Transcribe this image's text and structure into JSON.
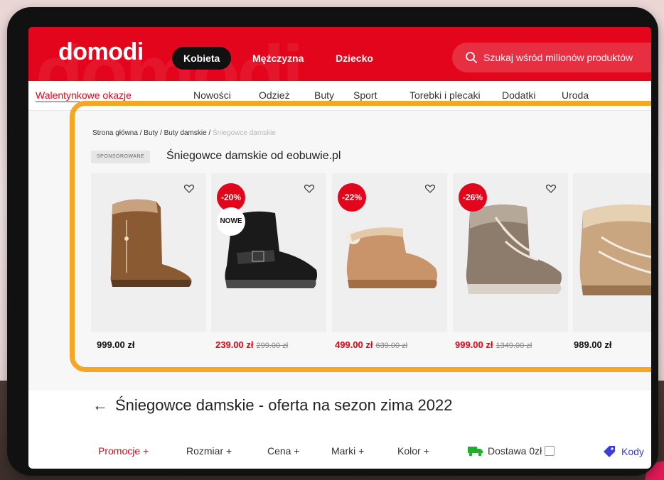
{
  "header": {
    "logo": "domodi",
    "tabs": [
      {
        "label": "Kobieta",
        "active": true
      },
      {
        "label": "Mężczyzna",
        "active": false
      },
      {
        "label": "Dziecko",
        "active": false
      }
    ],
    "search_placeholder": "Szukaj wśród milionów produktów"
  },
  "subnav": {
    "items": [
      "Walentynkowe okazje",
      "Nowości",
      "Odzież",
      "Buty",
      "Sport",
      "Torebki i plecaki",
      "Dodatki",
      "Uroda"
    ]
  },
  "breadcrumb": {
    "items": [
      "Strona główna",
      "Buty",
      "Buty damskie"
    ],
    "current": "Śniegowce damskie"
  },
  "sponsored": {
    "tag": "SPONSOROWANE",
    "title": "Śniegowce damskie od eobuwie.pl"
  },
  "products": [
    {
      "price": "999.00 zł",
      "old_price": "",
      "discount": "",
      "new_badge": ""
    },
    {
      "price": "239.00 zł",
      "old_price": "299.00 zł",
      "discount": "-20%",
      "new_badge": "NOWE"
    },
    {
      "price": "499.00 zł",
      "old_price": "639.00 zł",
      "discount": "-22%",
      "new_badge": ""
    },
    {
      "price": "999.00 zł",
      "old_price": "1349.00 zł",
      "discount": "-26%",
      "new_badge": ""
    },
    {
      "price": "989.00 zł",
      "old_price": "",
      "discount": "",
      "new_badge": ""
    }
  ],
  "page_title": "Śniegowce damskie - oferta na sezon zima 2022",
  "filters": {
    "promocje": "Promocje +",
    "rozmiar": "Rozmiar +",
    "cena": "Cena +",
    "marki": "Marki +",
    "kolor": "Kolor +",
    "dostawa": "Dostawa 0zł",
    "kody": "Kody"
  },
  "colors": {
    "brand": "#e3051b",
    "highlight_frame": "#f5a623"
  }
}
